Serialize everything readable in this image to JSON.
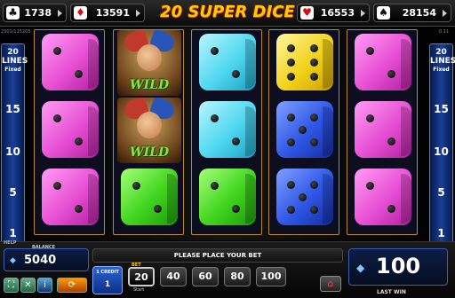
{
  "header": {
    "title": "20 SUPER DICE",
    "jackpots": [
      {
        "suit": "clubs",
        "glyph": "♣",
        "color": "#111111",
        "value": "1738"
      },
      {
        "suit": "diamonds",
        "glyph": "♦",
        "color": "#d01010",
        "value": "13591"
      },
      {
        "suit": "hearts",
        "glyph": "♥",
        "color": "#d01010",
        "value": "16553"
      },
      {
        "suit": "spades",
        "glyph": "♠",
        "color": "#111111",
        "value": "28154"
      }
    ]
  },
  "meta": {
    "left_code": "2301/115205",
    "right_code": "0.11"
  },
  "side_panel": {
    "lines_label": "20",
    "lines_word": "LINES",
    "fixed_word": "Fixed",
    "line_numbers": [
      "15",
      "10",
      "5",
      "1"
    ]
  },
  "reels": [
    [
      {
        "kind": "die",
        "color": "magenta",
        "value": 2
      },
      {
        "kind": "die",
        "color": "magenta",
        "value": 2
      },
      {
        "kind": "die",
        "color": "magenta",
        "value": 2
      }
    ],
    [
      {
        "kind": "wild",
        "label": "WILD"
      },
      {
        "kind": "wild",
        "label": "WILD"
      },
      {
        "kind": "die",
        "color": "green",
        "value": 2
      }
    ],
    [
      {
        "kind": "die",
        "color": "cyan",
        "value": 2
      },
      {
        "kind": "die",
        "color": "cyan",
        "value": 2
      },
      {
        "kind": "die",
        "color": "green",
        "value": 2
      }
    ],
    [
      {
        "kind": "die",
        "color": "yellow",
        "value": 6
      },
      {
        "kind": "die",
        "color": "blue",
        "value": 5
      },
      {
        "kind": "die",
        "color": "blue",
        "value": 5
      }
    ],
    [
      {
        "kind": "die",
        "color": "magenta",
        "value": 2
      },
      {
        "kind": "die",
        "color": "magenta",
        "value": 2
      },
      {
        "kind": "die",
        "color": "magenta",
        "value": 2
      }
    ]
  ],
  "footer": {
    "help_label": "HELP",
    "balance_label": "BALANCE",
    "balance_value": "5040",
    "message": "PLEASE PLACE YOUR BET",
    "credit_label": "1 CREDIT",
    "credit_value": "1",
    "bet_label": "BET",
    "bets": [
      "20",
      "40",
      "60",
      "80",
      "100"
    ],
    "selected_bet": "20",
    "start_label": "Start",
    "last_win_value": "100",
    "last_win_label": "LAST WIN"
  },
  "icons": [
    "fullscreen-icon",
    "expand-icon",
    "info-icon",
    "autoplay-icon",
    "home-icon"
  ]
}
